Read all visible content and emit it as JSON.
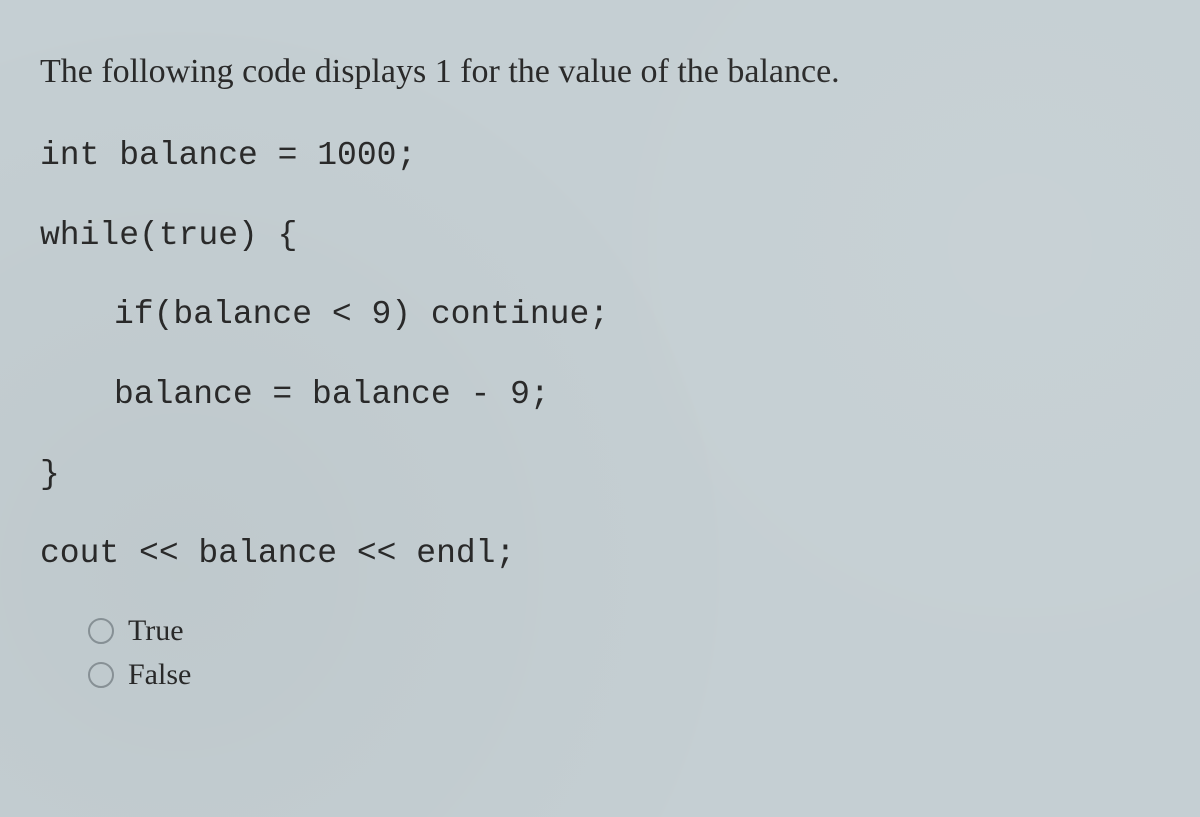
{
  "question": {
    "prompt": "The following code displays 1 for the value of the balance."
  },
  "code": {
    "line1": "int balance = 1000;",
    "line2": "while(true) {",
    "line3": "if(balance < 9) continue;",
    "line4": "balance = balance - 9;",
    "line5": "}",
    "line6": "cout << balance << endl;"
  },
  "options": {
    "opt_true": "True",
    "opt_false": "False"
  }
}
